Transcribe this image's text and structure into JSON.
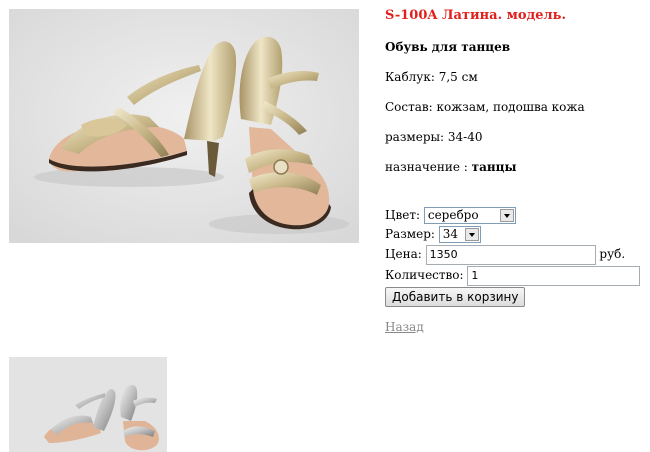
{
  "product": {
    "title": "S-100A Латина. модель.",
    "subtitle": "Обувь для танцев",
    "heel": "Каблук: 7,5 см",
    "composition": "Состав: кожзам, подошва кожа",
    "sizes": "размеры: 34-40",
    "purpose_label": "назначение :",
    "purpose_value": "танцы"
  },
  "images": {
    "main_alt": "shoe-photo",
    "thumb_alt": "shoe-photo-thumbnail"
  },
  "form": {
    "color_label": "Цвет:",
    "color_value": "серебро",
    "size_label": "Размер:",
    "size_value": "34",
    "price_label": "Цена:",
    "price_value": "1350",
    "currency": "руб.",
    "qty_label": "Количество:",
    "qty_value": "1",
    "add_button": "Добавить в корзину"
  },
  "nav": {
    "back_link": "Назад"
  }
}
